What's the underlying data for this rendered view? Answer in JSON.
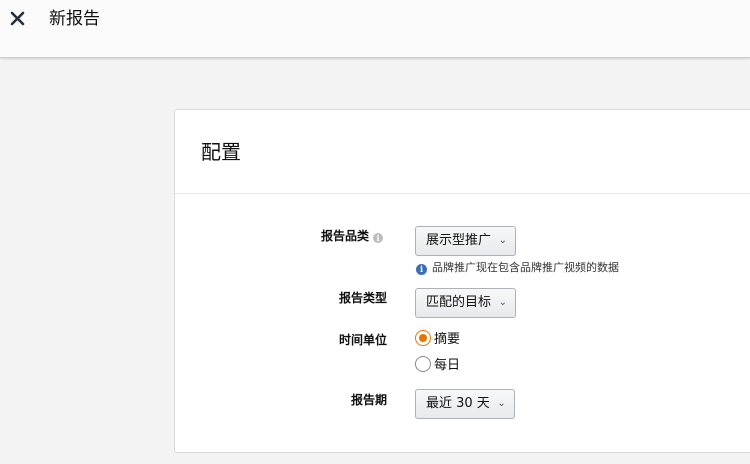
{
  "header": {
    "title": "新报告",
    "close_icon": "close-icon"
  },
  "config": {
    "title": "配置",
    "report_category": {
      "label": "报告品类",
      "info_icon": "info-icon",
      "selected": "展示型推广",
      "note": "品牌推广现在包含品牌推广视频的数据"
    },
    "report_type": {
      "label": "报告类型",
      "selected": "匹配的目标"
    },
    "time_unit": {
      "label": "时间单位",
      "options": [
        {
          "label": "摘要",
          "checked": true
        },
        {
          "label": "每日",
          "checked": false
        }
      ]
    },
    "report_period": {
      "label": "报告期",
      "selected": "最近 30 天"
    }
  },
  "colors": {
    "accent": "#e77600",
    "info": "#3b6fb5"
  }
}
